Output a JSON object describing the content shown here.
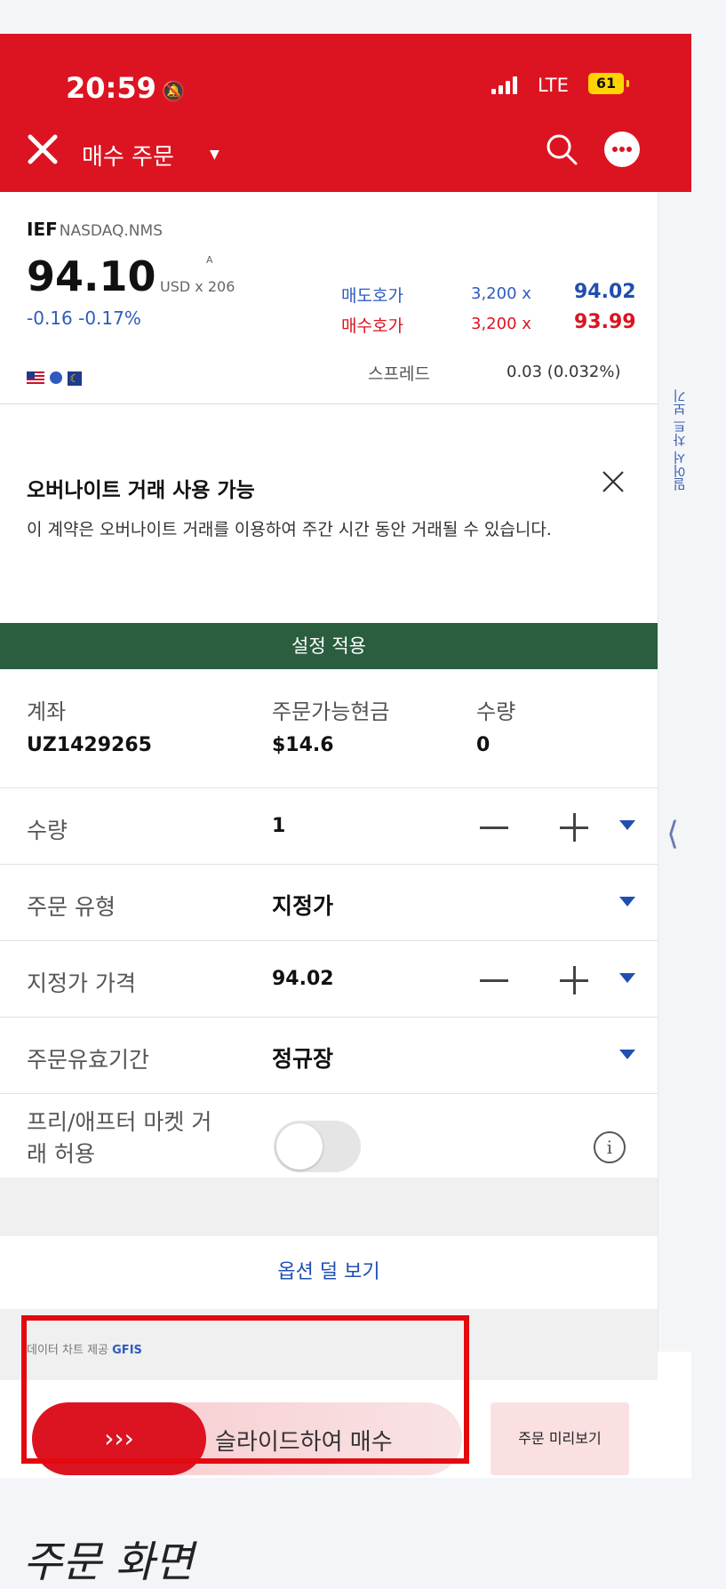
{
  "status_bar": {
    "time": "20:59",
    "network": "LTE",
    "battery": "61"
  },
  "header": {
    "title": "매수 주문"
  },
  "quote": {
    "symbol": "IEF",
    "exchange": "NASDAQ.NMS",
    "price": "94.10",
    "tick_marker": "A",
    "currency_size": "USD x 206",
    "change": "-0.16 -0.17%",
    "ask_label": "매도호가",
    "ask_size": "3,200 x",
    "ask_price": "94.02",
    "bid_label": "매수호가",
    "bid_size": "3,200 x",
    "bid_price": "93.99",
    "spread_label": "스프레드",
    "spread_value": "0.03 (0.032%)"
  },
  "banner": {
    "title": "오버나이트 거래 사용 가능",
    "text": "이 계약은 오버나이트 거래를 이용하여 주간 시간 동안 거래될 수 있습니다."
  },
  "apply_button": "설정 적용",
  "account": {
    "account_label": "계좌",
    "account_value": "UZ1429265",
    "cash_label": "주문가능현금",
    "cash_value": "$14.6",
    "qty_label": "수량",
    "qty_value": "0"
  },
  "form": {
    "quantity_label": "수량",
    "quantity_value": "1",
    "order_type_label": "주문 유형",
    "order_type_value": "지정가",
    "limit_price_label": "지정가 가격",
    "limit_price_value": "94.02",
    "tif_label": "주문유효기간",
    "tif_value": "정규장",
    "extended_label": "프리/애프터 마켓 거래 허용"
  },
  "less_options": "옵션 덜 보기",
  "data_source": {
    "text": "데이터 차트 제공",
    "brand": "GFIS"
  },
  "slider": {
    "arrows": "›››",
    "label": "슬라이드하여 매수"
  },
  "preview_button": "주문 미리보기",
  "side_panel": {
    "label": "밀어서 차트 보기"
  },
  "caption": "주문 화면",
  "colors": {
    "brand_red": "#dc1422",
    "apply_green": "#2a5e3f",
    "link_blue": "#1f4fb0"
  }
}
